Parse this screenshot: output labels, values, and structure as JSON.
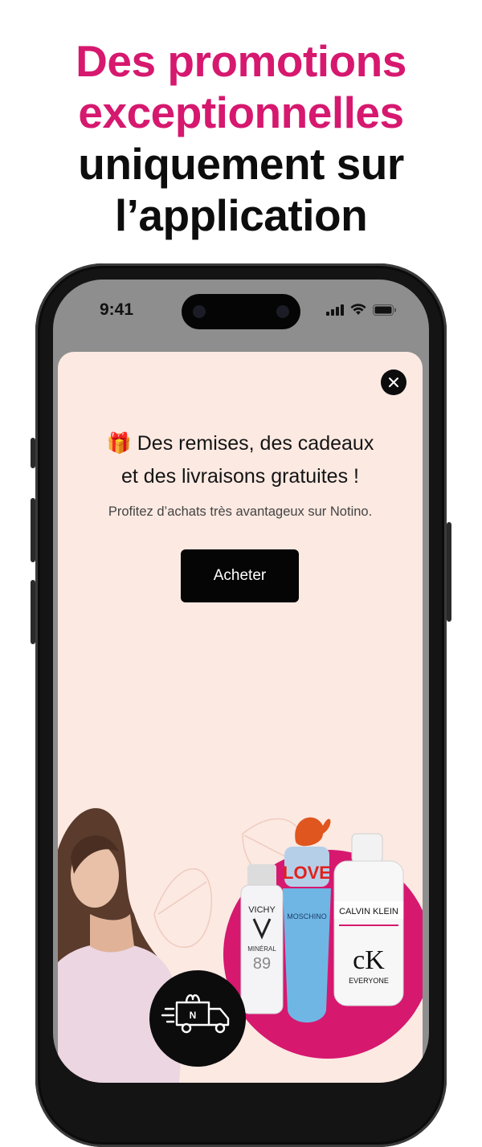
{
  "headline": {
    "line1": "Des promotions",
    "line2": "exceptionnelles",
    "line3": "uniquement sur",
    "line4": "l’application"
  },
  "status_bar": {
    "time": "9:41"
  },
  "modal": {
    "title_line1": "Des remises, des cadeaux",
    "title_line2": "et des livraisons gratuites !",
    "gift_emoji": "🎁",
    "subtitle": "Profitez d’achats très avantageux sur Notino.",
    "button_label": "Acheter"
  },
  "products": {
    "vichy_brand": "VICHY",
    "vichy_name": "MINÉRAL",
    "vichy_number": "89",
    "moschino_top": "LOVE",
    "moschino_brand": "MOSCHINO",
    "ck_brand": "CALVIN KLEIN",
    "ck_logo": "cK",
    "ck_name": "EVERYONE",
    "delivery_badge_letter": "N"
  },
  "colors": {
    "brand_pink": "#d6186f",
    "modal_bg": "#fbe9e2",
    "cta_bg": "#050505"
  }
}
